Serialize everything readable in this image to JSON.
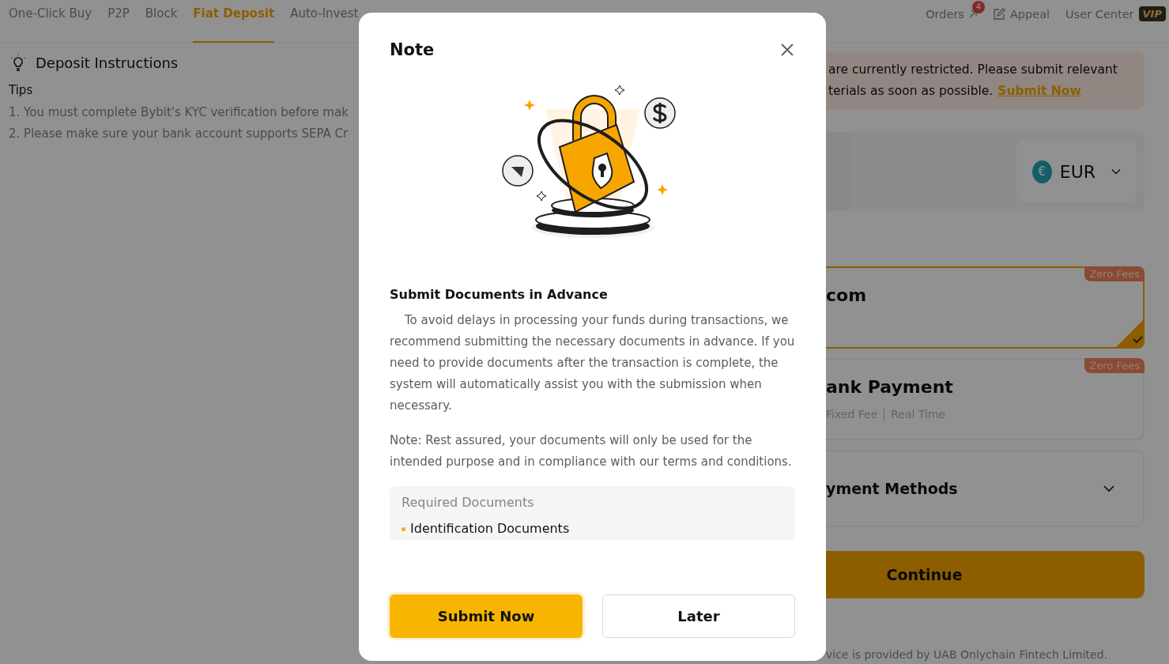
{
  "tabs": [
    {
      "label": "One-Click Buy",
      "selected": false
    },
    {
      "label": "P2P",
      "selected": false
    },
    {
      "label": "Block",
      "selected": false
    },
    {
      "label": "Fiat Deposit",
      "selected": true
    },
    {
      "label": "Auto-Invest",
      "selected": false
    }
  ],
  "header_links": [
    {
      "kind": "orders",
      "label": "Orders",
      "badge": "4"
    },
    {
      "kind": "appeal",
      "label": "Appeal"
    },
    {
      "kind": "user",
      "label": "User Center",
      "badge": "VIP"
    }
  ],
  "instructions": {
    "title": "Deposit Instructions",
    "subtitle": "Tips",
    "items": [
      "1. You must complete Bybit's KYC verification before mak",
      "2. Please make sure your bank account supports SEPA Cr"
    ]
  },
  "banner": {
    "lines": [
      "are currently restricted. Please submit relevant",
      "terials as soon as possible."
    ],
    "link": "Submit Now"
  },
  "currency": {
    "symbol": "€",
    "code": "EUR"
  },
  "methods": [
    {
      "kind": "option",
      "title": "com",
      "badge": "Zero Fees",
      "selected": true
    },
    {
      "kind": "option",
      "title": "ank Payment",
      "badge": "Zero Fees",
      "details": [
        "Fixed Fee",
        "Real Time"
      ],
      "selected": false
    },
    {
      "kind": "more",
      "title": "yment Methods"
    }
  ],
  "continue_button": "Continue",
  "footer": "vice is provided by UAB Onlychain Fintech Limited.",
  "modal": {
    "title": "Note",
    "heading": "Submit Documents in Advance",
    "paragraphs": [
      "To avoid delays in processing your funds during transactions, we recommend submitting the necessary documents in advance. If you need to provide documents after the transaction is complete, the system will automatically assist you with the submission when necessary.",
      "Note: Rest assured, your documents will only be used for the intended purpose and in compliance with our terms and conditions."
    ],
    "required": {
      "title": "Required Documents",
      "items": [
        "Identification Documents"
      ]
    },
    "buttons": [
      {
        "kind": "primary",
        "label": "Submit Now"
      },
      {
        "kind": "secondary",
        "label": "Later"
      }
    ]
  }
}
